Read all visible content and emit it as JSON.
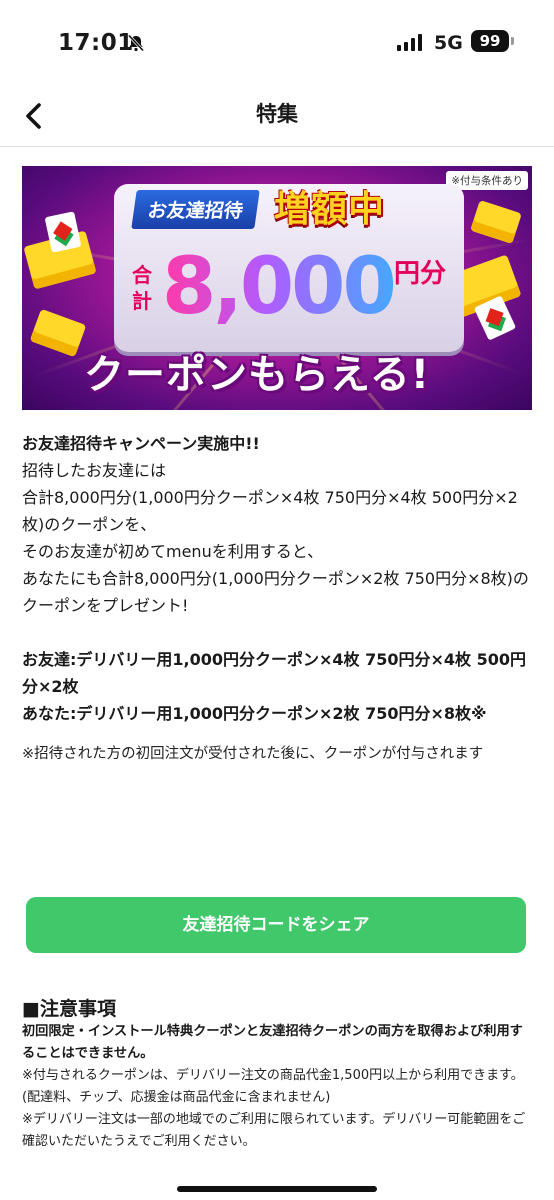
{
  "status_bar": {
    "time": "17:01",
    "network": "5G",
    "battery": "99"
  },
  "nav": {
    "title": "特集"
  },
  "banner": {
    "note": "※付与条件あり",
    "invite_tag": "お友達招待",
    "increase_label": "増額中",
    "total_label": "合計",
    "amount": "8,000",
    "yen_label": "円分",
    "headline": "クーポンもらえる!"
  },
  "article": {
    "heading": "お友達招待キャンペーン実施中!!",
    "line1": "招待したお友達には",
    "line2": "合計8,000円分(1,000円分クーポン×4枚 750円分×4枚 500円分×2枚)のクーポンを、",
    "line3": "そのお友達が初めてmenuを利用すると、",
    "line4": "あなたにも合計8,000円分(1,000円分クーポン×2枚 750円分×8枚)のクーポンをプレゼント!",
    "friend_line": "お友達:デリバリー用1,000円分クーポン×4枚 750円分×4枚 500円分×2枚",
    "you_line": "あなた:デリバリー用1,000円分クーポン×2枚 750円分×8枚※",
    "footnote": "※招待された方の初回注文が受付された後に、クーポンが付与されます"
  },
  "share_button": {
    "label": "友達招待コードをシェア"
  },
  "notice": {
    "title": "■注意事項",
    "bold": "初回限定・インストール特典クーポンと友達招待クーポンの両方を取得および利用することはできません。",
    "text1": "※付与されるクーポンは、デリバリー注文の商品代金1,500円以上から利用できます。(配達料、チップ、応援金は商品代金に含まれません)",
    "text2": "※デリバリー注文は一部の地域でのご利用に限られています。デリバリー可能範囲をご確認いただいたうえでご利用ください。"
  }
}
